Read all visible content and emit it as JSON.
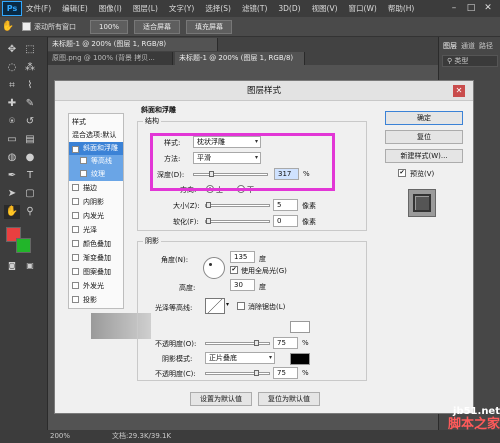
{
  "app": {
    "logo": "Ps"
  },
  "menu": [
    "文件(F)",
    "编辑(E)",
    "图像(I)",
    "图层(L)",
    "文字(Y)",
    "选择(S)",
    "滤镜(T)",
    "3D(D)",
    "视图(V)",
    "窗口(W)",
    "帮助(H)"
  ],
  "options": {
    "scroll_all": "滚动所有窗口",
    "zoom": "100%",
    "fit_screen": "适合屏幕",
    "fill_screen": "填充屏幕"
  },
  "doctabs": {
    "active": "未标题-1 @ 200% (图层 1, RGB/8)",
    "tab1": "原图.png @ 100% (背景 拷贝...",
    "tab2": "未标题-1 @ 200% (图层 1, RGB/8)"
  },
  "rightpanel": {
    "tab1": "图层",
    "tab2": "通道",
    "tab3": "路径",
    "filter": "类型"
  },
  "status": {
    "zoom": "200%",
    "doc": "文档:29.3K/39.1K"
  },
  "dialog": {
    "title": "图层样式",
    "sidebar": {
      "header": "样式",
      "blend": "混合选项:默认",
      "bevel": "斜面和浮雕",
      "contour": "等高线",
      "texture": "纹理",
      "stroke": "描边",
      "inner_shadow": "内阴影",
      "inner_glow": "内发光",
      "satin": "光泽",
      "color_overlay": "颜色叠加",
      "gradient_overlay": "渐变叠加",
      "pattern_overlay": "图案叠加",
      "outer_glow": "外发光",
      "drop_shadow": "投影"
    },
    "section": "斜面和浮雕",
    "structure": {
      "title": "结构",
      "style_label": "样式:",
      "style_value": "枕状浮雕",
      "technique_label": "方法:",
      "technique_value": "平滑",
      "depth_label": "深度(D):",
      "depth_value": "317",
      "depth_unit": "%",
      "depth_pct": 0.22,
      "direction_label": "方向:",
      "up": "上",
      "down": "下",
      "size_label": "大小(Z):",
      "size_value": "5",
      "size_unit": "像素",
      "soften_label": "软化(F):",
      "soften_value": "0",
      "soften_unit": "像素"
    },
    "shading": {
      "title": "阴影",
      "angle_label": "角度(N):",
      "angle_value": "135",
      "angle_unit": "度",
      "global_light": "使用全局光(G)",
      "altitude_label": "高度:",
      "altitude_value": "30",
      "altitude_unit": "度",
      "gloss_label": "光泽等高线:",
      "antialias": "消除锯齿(L)",
      "hl_opacity_label": "不透明度(O):",
      "hl_opacity_value": "75",
      "hl_unit": "%",
      "shadow_mode_label": "阴影模式:",
      "shadow_mode_value": "正片叠底",
      "sh_opacity_label": "不透明度(C):",
      "sh_opacity_value": "75",
      "sh_unit": "%"
    },
    "buttons": {
      "make_default": "设置为默认值",
      "reset_default": "复位为默认值",
      "ok": "确定",
      "reset": "复位",
      "new_style": "新建样式(W)...",
      "preview": "预览(V)"
    }
  },
  "watermark": {
    "line1": "jb51.net",
    "line2": "脚本之家"
  },
  "colors": {
    "magenta": "#e236d6",
    "fg": "#e84040",
    "bg": "#22b52a",
    "accent": "#3b82d6"
  }
}
